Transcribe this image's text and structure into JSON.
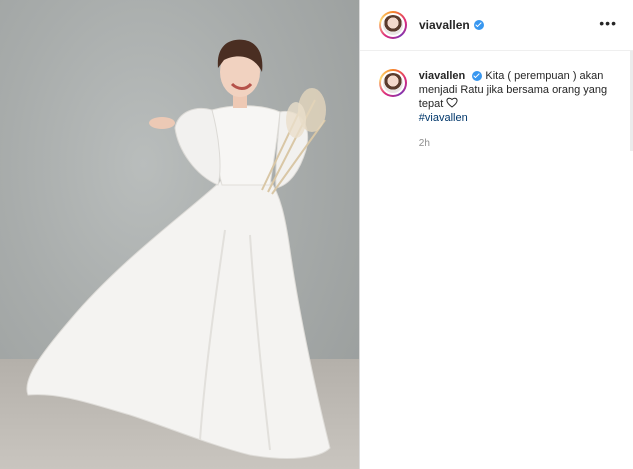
{
  "post": {
    "username": "viavallen",
    "verified": true,
    "more_label": "•••",
    "caption": {
      "username": "viavallen",
      "text": "Kita ( perempuan ) akan menjadi Ratu jika bersama orang yang tepat",
      "hashtag": "#viavallen",
      "time": "2h"
    }
  },
  "icons": [
    "verified-badge-icon",
    "more-options-icon",
    "heart-outline-icon"
  ],
  "colors": {
    "link": "#00376b",
    "verified": "#3897f0",
    "muted": "#8e8e8e"
  }
}
